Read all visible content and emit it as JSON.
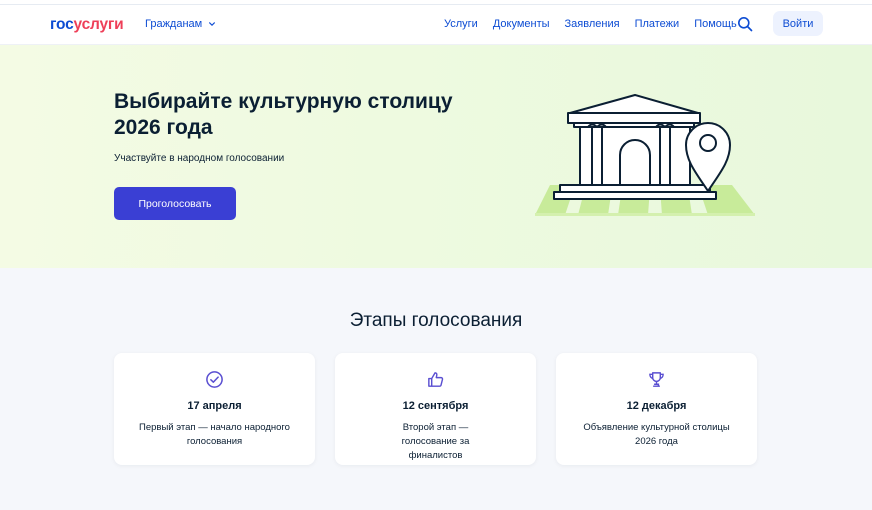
{
  "header": {
    "logo_part1": "гос",
    "logo_part2": "услуги",
    "citizens_label": "Гражданам",
    "nav": [
      "Услуги",
      "Документы",
      "Заявления",
      "Платежи",
      "Помощь"
    ],
    "login_label": "Войти"
  },
  "hero": {
    "title": "Выбирайте культурную столицу 2026 года",
    "subtitle": "Участвуйте в народном голосовании",
    "vote_button": "Проголосовать"
  },
  "stages": {
    "title": "Этапы голосования",
    "cards": [
      {
        "icon": "check-circle-icon",
        "date": "17 апреля",
        "desc": "Первый этап — начало народного голосования"
      },
      {
        "icon": "thumbs-up-icon",
        "date": "12 сентября",
        "desc": "Второй этап — голосование за финалистов"
      },
      {
        "icon": "trophy-icon",
        "date": "12 декабря",
        "desc": "Объявление культурной столицы 2026 года"
      }
    ]
  },
  "colors": {
    "brand_blue": "#0d4cd3",
    "brand_red": "#ee3f58",
    "button_purple": "#3a3fd4",
    "icon_violet": "#5a4fd1"
  }
}
